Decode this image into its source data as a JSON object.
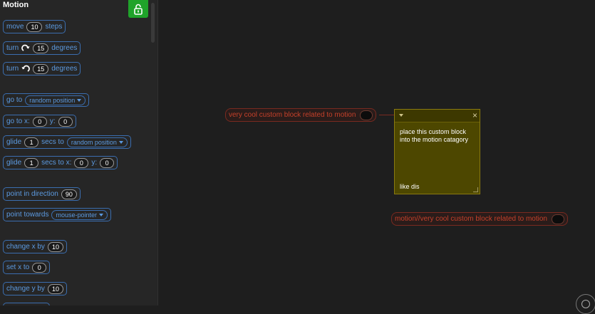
{
  "palette": {
    "category_title": "Motion",
    "blocks": {
      "move": {
        "label": "move",
        "steps": "10",
        "suffix": "steps"
      },
      "turn_right": {
        "label": "turn",
        "degrees": "15",
        "suffix": "degrees"
      },
      "turn_left": {
        "label": "turn",
        "degrees": "15",
        "suffix": "degrees"
      },
      "go_to": {
        "label": "go to",
        "target": "random position"
      },
      "go_to_xy": {
        "label": "go to x:",
        "x": "0",
        "y_label": "y:",
        "y": "0"
      },
      "glide_to": {
        "label": "glide",
        "secs": "1",
        "mid": "secs to",
        "target": "random position"
      },
      "glide_xy": {
        "label": "glide",
        "secs": "1",
        "mid": "secs to x:",
        "x": "0",
        "y_label": "y:",
        "y": "0"
      },
      "point_dir": {
        "label": "point in direction",
        "value": "90"
      },
      "point_towards": {
        "label": "point towards",
        "target": "mouse-pointer"
      },
      "change_x": {
        "label": "change x by",
        "value": "10"
      },
      "set_x": {
        "label": "set x to",
        "value": "0"
      },
      "change_y": {
        "label": "change y by",
        "value": "10"
      }
    }
  },
  "workspace": {
    "define_block_label": "very cool custom block related to motion",
    "motion_block_label": "motion//very cool custom block related to motion",
    "comment": {
      "text": "place this custom block into the motion catagory\n\n\n\n\n\nlike dis",
      "close": "×"
    }
  },
  "colors": {
    "motion_blue": "#5c9ae0",
    "custom_red": "#c4402a",
    "lock_green": "#1fa32a",
    "comment_bg": "#4d4700"
  }
}
